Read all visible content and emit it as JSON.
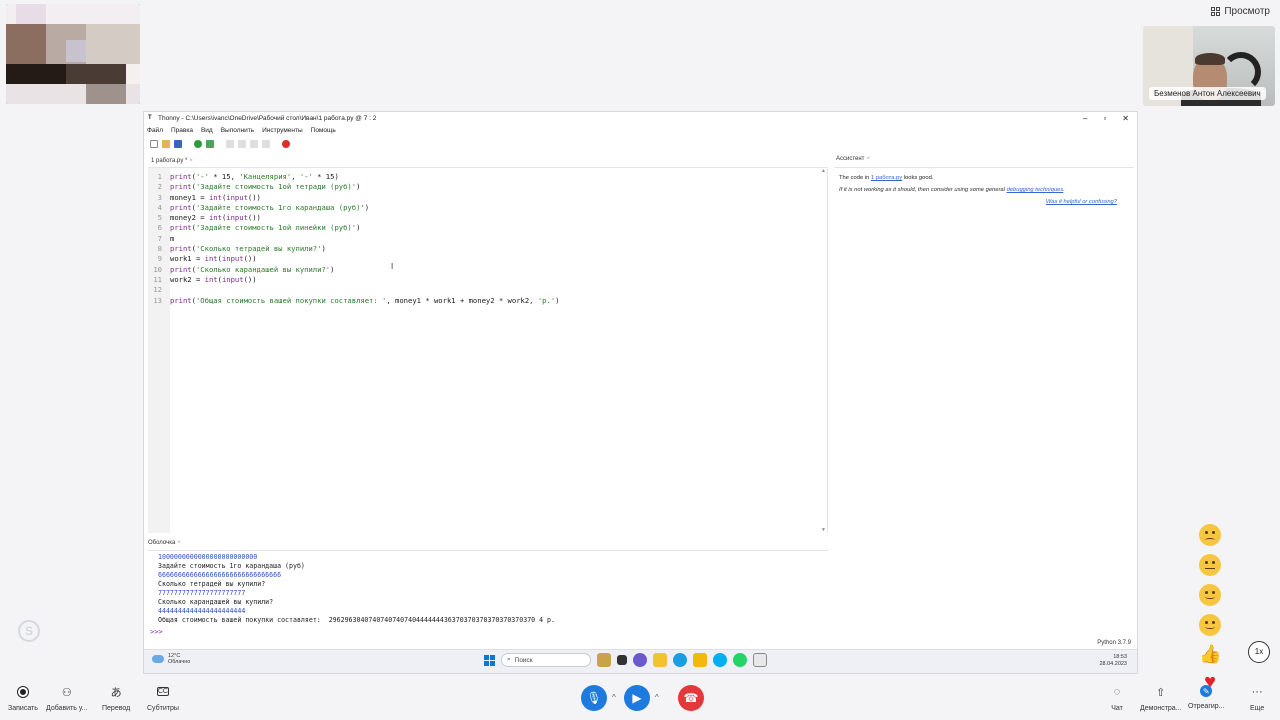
{
  "top_right": {
    "preview_label": "Просмотр"
  },
  "participant": {
    "name": "Безменов Антон Алексеевич"
  },
  "window": {
    "title": "Thonny  -  C:\\Users\\ivanc\\OneDrive\\Рабочий стол\\Иван\\1 работа.py  @  7 : 2",
    "menu": [
      "Файл",
      "Правка",
      "Вид",
      "Выполнить",
      "Инструменты",
      "Помощь"
    ],
    "editor_tab": "1 работа.py *",
    "assistant_tab": "Ассистент",
    "shell_tab": "Оболочка",
    "status": "Python 3.7.9"
  },
  "code_lines": [
    {
      "n": "1",
      "parts": [
        [
          "k",
          "print"
        ],
        [
          "t",
          "("
        ],
        [
          "s",
          "'-'"
        ],
        [
          "t",
          " * 15, "
        ],
        [
          "s",
          "'Канцелярия'"
        ],
        [
          "t",
          ", "
        ],
        [
          "s",
          "'-'"
        ],
        [
          "t",
          " * 15)"
        ]
      ]
    },
    {
      "n": "2",
      "parts": [
        [
          "k",
          "print"
        ],
        [
          "t",
          "("
        ],
        [
          "s",
          "'Задайте стоимость 1ой тетради (руб)'"
        ],
        [
          "t",
          ")"
        ]
      ]
    },
    {
      "n": "3",
      "parts": [
        [
          "t",
          "money1 = "
        ],
        [
          "k",
          "int"
        ],
        [
          "t",
          "("
        ],
        [
          "k",
          "input"
        ],
        [
          "t",
          "())"
        ]
      ]
    },
    {
      "n": "4",
      "parts": [
        [
          "k",
          "print"
        ],
        [
          "t",
          "("
        ],
        [
          "s",
          "'Задайте стоимость 1го карандаша (руб)'"
        ],
        [
          "t",
          ")"
        ]
      ]
    },
    {
      "n": "5",
      "parts": [
        [
          "t",
          "money2 = "
        ],
        [
          "k",
          "int"
        ],
        [
          "t",
          "("
        ],
        [
          "k",
          "input"
        ],
        [
          "t",
          "())"
        ]
      ]
    },
    {
      "n": "6",
      "parts": [
        [
          "k",
          "print"
        ],
        [
          "t",
          "("
        ],
        [
          "s",
          "'Задайте стоимость 1ой линейки (руб)'"
        ],
        [
          "t",
          ")"
        ]
      ]
    },
    {
      "n": "7",
      "parts": [
        [
          "t",
          "m"
        ]
      ]
    },
    {
      "n": "8",
      "parts": [
        [
          "k",
          "print"
        ],
        [
          "t",
          "("
        ],
        [
          "s",
          "'Сколько тетрадей вы купили?'"
        ],
        [
          "t",
          ")"
        ]
      ]
    },
    {
      "n": "9",
      "parts": [
        [
          "t",
          "work1 = "
        ],
        [
          "k",
          "int"
        ],
        [
          "t",
          "("
        ],
        [
          "k",
          "input"
        ],
        [
          "t",
          "())"
        ]
      ]
    },
    {
      "n": "10",
      "parts": [
        [
          "k",
          "print"
        ],
        [
          "t",
          "("
        ],
        [
          "s",
          "'Сколько карандашей вы купили?'"
        ],
        [
          "t",
          ")"
        ]
      ]
    },
    {
      "n": "11",
      "parts": [
        [
          "t",
          "work2 = "
        ],
        [
          "k",
          "int"
        ],
        [
          "t",
          "("
        ],
        [
          "k",
          "input"
        ],
        [
          "t",
          "())"
        ]
      ]
    },
    {
      "n": "12",
      "parts": []
    },
    {
      "n": "13",
      "parts": [
        [
          "k",
          "print"
        ],
        [
          "t",
          "("
        ],
        [
          "s",
          "'Общая стоимость вашей покупки составляет: '"
        ],
        [
          "t",
          ", money1 * work1 + money2 * work2, "
        ],
        [
          "s",
          "'р.'"
        ],
        [
          "t",
          ")"
        ]
      ]
    }
  ],
  "assistant": {
    "line1_pre": "The code in ",
    "line1_link": "1 работа.py",
    "line1_post": " looks good.",
    "line2_pre": "If it is not working as it should, then consider using some general ",
    "line2_link": "debugging techniques",
    "line2_post": ".",
    "helpful": "Was it helpful or confusing?"
  },
  "shell_lines": [
    {
      "cls": "blue",
      "text": "1000000000000000000000000"
    },
    {
      "cls": "",
      "text": "Задайте стоимость 1го карандаша (руб)"
    },
    {
      "cls": "blue",
      "text": "6666666666666666666666666666666"
    },
    {
      "cls": "",
      "text": "Сколько тетрадей вы купили?"
    },
    {
      "cls": "blue",
      "text": "7777777777777777777777"
    },
    {
      "cls": "",
      "text": "Сколько карандашей вы купили?"
    },
    {
      "cls": "blue",
      "text": "4444444444444444444444"
    },
    {
      "cls": "",
      "text": "Общая стоимость вашей покупки составляет:  2962963040740740740740444444436370370370370370370370 4 р."
    }
  ],
  "shell_prompt": ">>>",
  "taskbar": {
    "temp": "12°C",
    "weather": "Облачно",
    "search": "Поиск",
    "time": "18:53",
    "date": "28.04.2023"
  },
  "speed": "1x",
  "callbar": {
    "record": "Записать",
    "add_user": "Добавить у...",
    "translate": "Перевод",
    "subtitles": "Субтитры",
    "chat": "Чат",
    "demo": "Демонстра...",
    "react": "Отреагир...",
    "more": "Еще"
  }
}
